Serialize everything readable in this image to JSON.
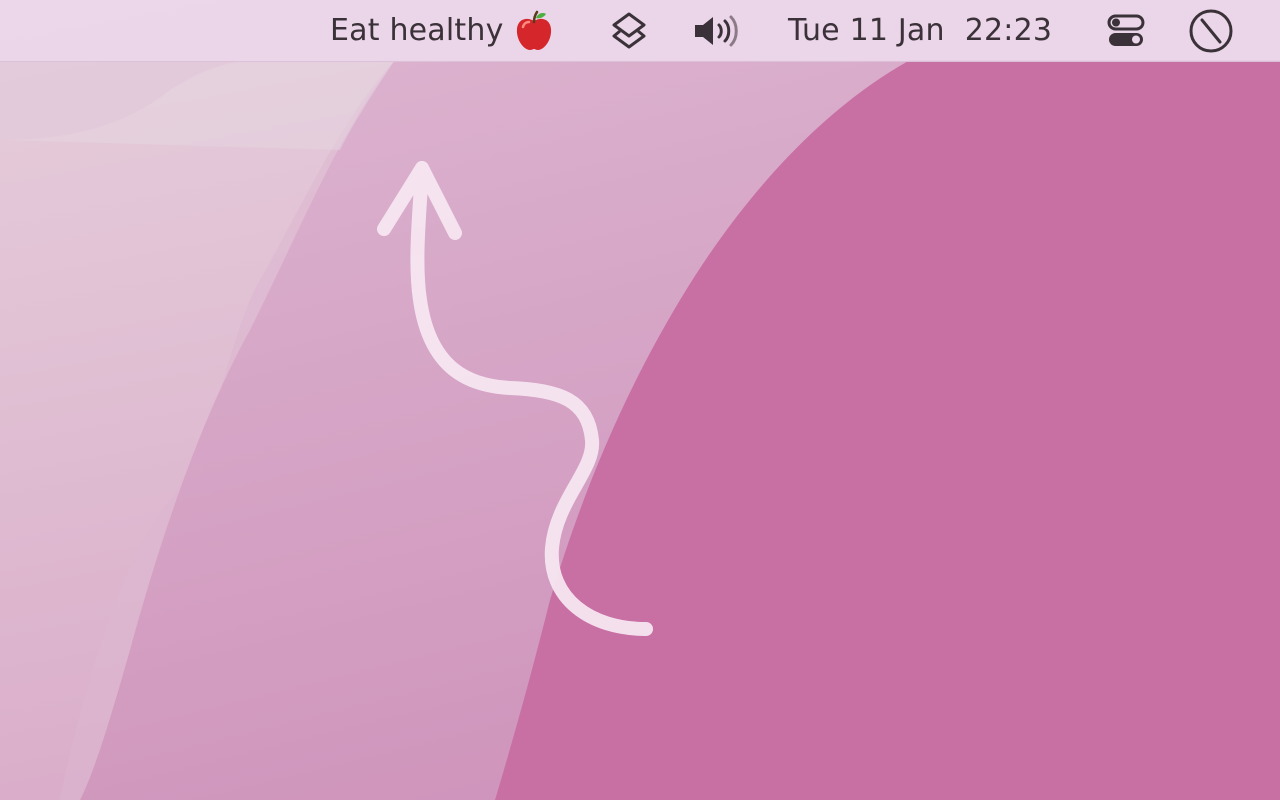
{
  "menubar": {
    "reminder": {
      "text": "Eat healthy",
      "icon": "red-apple-icon"
    },
    "shortcuts_icon": "shortcuts-layers-icon",
    "volume_icon": "speaker-volume-icon",
    "clock": {
      "date": "Tue 11 Jan",
      "time": "22:23"
    },
    "control_center_icon": "control-center-toggles-icon",
    "do_not_disturb_icon": "circle-slash-icon"
  },
  "desktop": {
    "arrow_icon": "curvy-up-arrow-icon",
    "colors": {
      "menubar": "#ecd6ea",
      "wallpaper_light": "#e3c4d6",
      "wallpaper_mid": "#d5a6c9",
      "wallpaper_dark": "#c86fa3",
      "arrow": "#f7e6f1"
    }
  }
}
